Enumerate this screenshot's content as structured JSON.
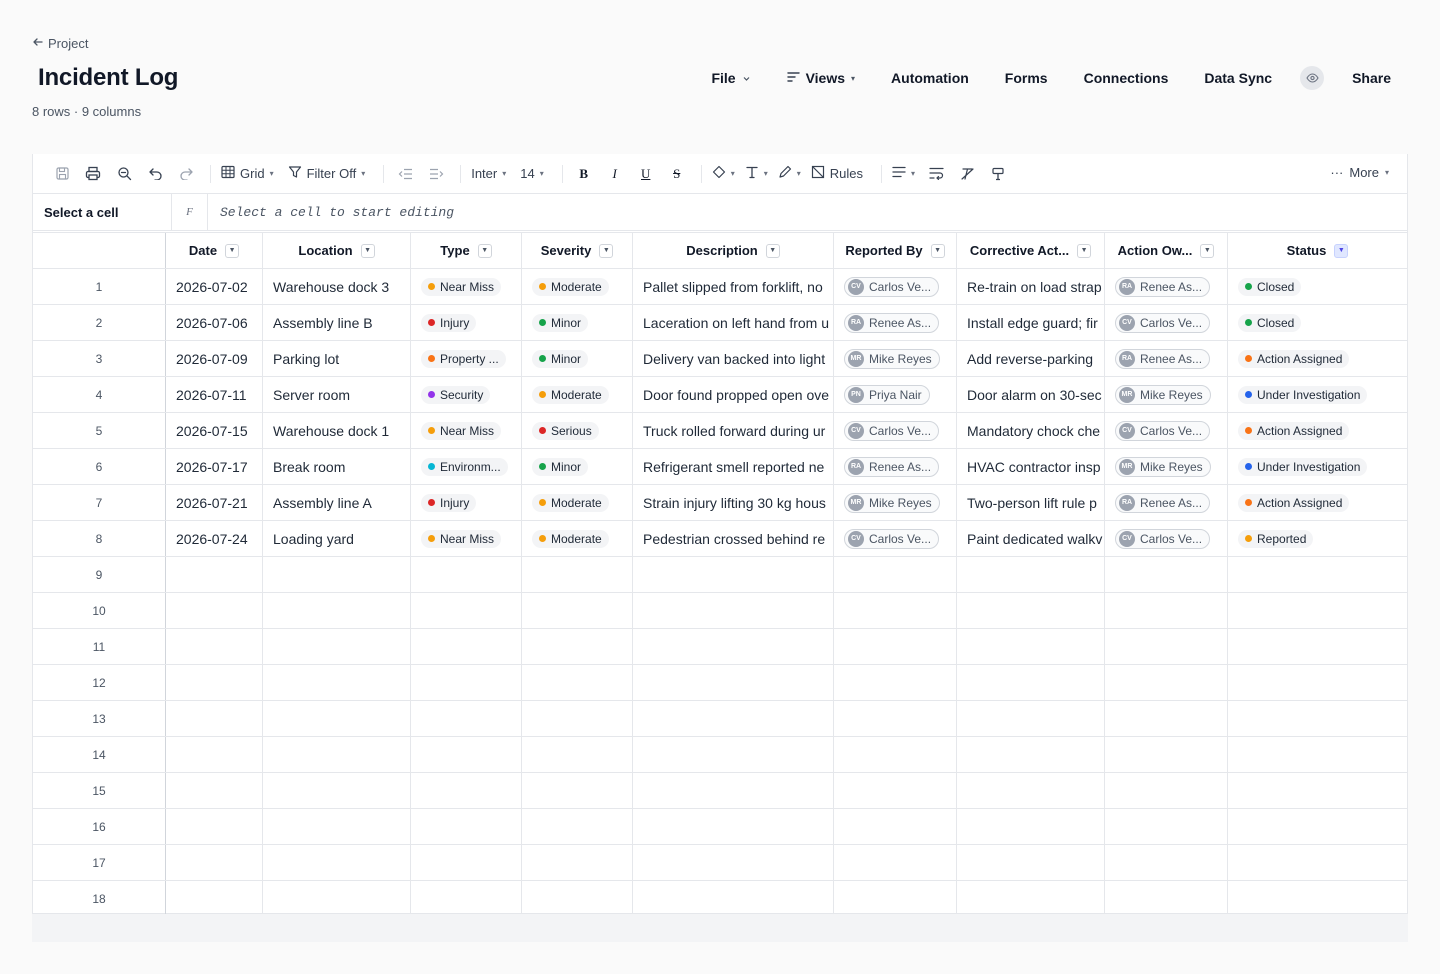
{
  "header": {
    "back_label": "Project",
    "title": "Incident Log",
    "subtitle": "8 rows · 9 columns"
  },
  "nav": {
    "file": "File",
    "views": "Views",
    "automation": "Automation",
    "forms": "Forms",
    "connections": "Connections",
    "data_sync": "Data Sync",
    "share": "Share"
  },
  "toolbar": {
    "view_mode": "Grid",
    "filter": "Filter Off",
    "font": "Inter",
    "font_size": "14",
    "bold": "B",
    "italic": "I",
    "underline": "U",
    "strike": "S",
    "rules": "Rules",
    "more": "More"
  },
  "formula_bar": {
    "cell_ref": "Select a cell",
    "fx": "F",
    "placeholder": "Select a cell to start editing"
  },
  "columns": [
    "Date",
    "Location",
    "Type",
    "Severity",
    "Description",
    "Reported By",
    "Corrective Act...",
    "Action Ow...",
    "Status"
  ],
  "colors": {
    "Near Miss": "#f59e0b",
    "Injury": "#dc2626",
    "Property ...": "#f97316",
    "Security": "#9333ea",
    "Environm...": "#06b6d4",
    "Moderate": "#f59e0b",
    "Minor": "#16a34a",
    "Serious": "#dc2626",
    "Closed": "#16a34a",
    "Action Assigned": "#f97316",
    "Under Investigation": "#2563eb",
    "Reported": "#f59e0b"
  },
  "rows": [
    {
      "num": "1",
      "date": "2026-07-02",
      "location": "Warehouse dock 3",
      "type": "Near Miss",
      "severity": "Moderate",
      "description": "Pallet slipped from forklift, no",
      "reported_initials": "CV",
      "reported_by": "Carlos Ve...",
      "corrective": "Re-train on load strap",
      "owner_initials": "RA",
      "owner": "Renee As...",
      "status": "Closed"
    },
    {
      "num": "2",
      "date": "2026-07-06",
      "location": "Assembly line B",
      "type": "Injury",
      "severity": "Minor",
      "description": "Laceration on left hand from u",
      "reported_initials": "RA",
      "reported_by": "Renee As...",
      "corrective": "Install edge guard; fir",
      "owner_initials": "CV",
      "owner": "Carlos Ve...",
      "status": "Closed"
    },
    {
      "num": "3",
      "date": "2026-07-09",
      "location": "Parking lot",
      "type": "Property ...",
      "severity": "Minor",
      "description": "Delivery van backed into light",
      "reported_initials": "MR",
      "reported_by": "Mike Reyes",
      "corrective": "Add reverse-parking",
      "owner_initials": "RA",
      "owner": "Renee As...",
      "status": "Action Assigned"
    },
    {
      "num": "4",
      "date": "2026-07-11",
      "location": "Server room",
      "type": "Security",
      "severity": "Moderate",
      "description": "Door found propped open ove",
      "reported_initials": "PN",
      "reported_by": "Priya Nair",
      "corrective": "Door alarm on 30-sec",
      "owner_initials": "MR",
      "owner": "Mike Reyes",
      "status": "Under Investigation"
    },
    {
      "num": "5",
      "date": "2026-07-15",
      "location": "Warehouse dock 1",
      "type": "Near Miss",
      "severity": "Serious",
      "description": "Truck rolled forward during ur",
      "reported_initials": "CV",
      "reported_by": "Carlos Ve...",
      "corrective": "Mandatory chock che",
      "owner_initials": "CV",
      "owner": "Carlos Ve...",
      "status": "Action Assigned"
    },
    {
      "num": "6",
      "date": "2026-07-17",
      "location": "Break room",
      "type": "Environm...",
      "severity": "Minor",
      "description": "Refrigerant smell reported ne",
      "reported_initials": "RA",
      "reported_by": "Renee As...",
      "corrective": "HVAC contractor insp",
      "owner_initials": "MR",
      "owner": "Mike Reyes",
      "status": "Under Investigation"
    },
    {
      "num": "7",
      "date": "2026-07-21",
      "location": "Assembly line A",
      "type": "Injury",
      "severity": "Moderate",
      "description": "Strain injury lifting 30 kg hous",
      "reported_initials": "MR",
      "reported_by": "Mike Reyes",
      "corrective": "Two-person lift rule p",
      "owner_initials": "RA",
      "owner": "Renee As...",
      "status": "Action Assigned"
    },
    {
      "num": "8",
      "date": "2026-07-24",
      "location": "Loading yard",
      "type": "Near Miss",
      "severity": "Moderate",
      "description": "Pedestrian crossed behind re",
      "reported_initials": "CV",
      "reported_by": "Carlos Ve...",
      "corrective": "Paint dedicated walkv",
      "owner_initials": "CV",
      "owner": "Carlos Ve...",
      "status": "Reported"
    }
  ],
  "empty_rows": [
    "9",
    "10",
    "11",
    "12",
    "13",
    "14",
    "15",
    "16",
    "17",
    "18"
  ]
}
